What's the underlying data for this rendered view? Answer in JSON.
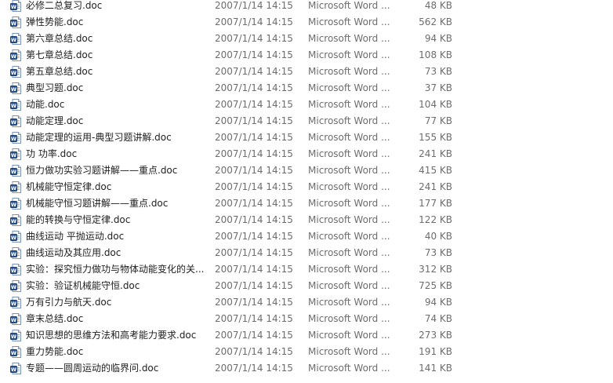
{
  "icons": {
    "file": "word-document-icon"
  },
  "colors": {
    "icon_blue": "#2b5797",
    "secondary_text": "#6d6d6d"
  },
  "files": [
    {
      "name": "必修二总复习.doc",
      "date": "2007/1/14 14:15",
      "type": "Microsoft Word ...",
      "size": "48 KB"
    },
    {
      "name": "弹性势能.doc",
      "date": "2007/1/14 14:15",
      "type": "Microsoft Word ...",
      "size": "562 KB"
    },
    {
      "name": "第六章总结.doc",
      "date": "2007/1/14 14:15",
      "type": "Microsoft Word ...",
      "size": "94 KB"
    },
    {
      "name": "第七章总结.doc",
      "date": "2007/1/14 14:15",
      "type": "Microsoft Word ...",
      "size": "108 KB"
    },
    {
      "name": "第五章总结.doc",
      "date": "2007/1/14 14:15",
      "type": "Microsoft Word ...",
      "size": "73 KB"
    },
    {
      "name": "典型习题.doc",
      "date": "2007/1/14 14:15",
      "type": "Microsoft Word ...",
      "size": "37 KB"
    },
    {
      "name": "动能.doc",
      "date": "2007/1/14 14:15",
      "type": "Microsoft Word ...",
      "size": "104 KB"
    },
    {
      "name": "动能定理.doc",
      "date": "2007/1/14 14:15",
      "type": "Microsoft Word ...",
      "size": "77 KB"
    },
    {
      "name": "动能定理的运用-典型习题讲解.doc",
      "date": "2007/1/14 14:15",
      "type": "Microsoft Word ...",
      "size": "155 KB"
    },
    {
      "name": "功 功率.doc",
      "date": "2007/1/14 14:15",
      "type": "Microsoft Word ...",
      "size": "241 KB"
    },
    {
      "name": "恒力做功实验习题讲解——重点.doc",
      "date": "2007/1/14 14:15",
      "type": "Microsoft Word ...",
      "size": "415 KB"
    },
    {
      "name": "机械能守恒定律.doc",
      "date": "2007/1/14 14:15",
      "type": "Microsoft Word ...",
      "size": "241 KB"
    },
    {
      "name": "机械能守恒习题讲解——重点.doc",
      "date": "2007/1/14 14:15",
      "type": "Microsoft Word ...",
      "size": "177 KB"
    },
    {
      "name": "能的转换与守恒定律.doc",
      "date": "2007/1/14 14:15",
      "type": "Microsoft Word ...",
      "size": "122 KB"
    },
    {
      "name": "曲线运动 平抛运动.doc",
      "date": "2007/1/14 14:15",
      "type": "Microsoft Word ...",
      "size": "40 KB"
    },
    {
      "name": "曲线运动及其应用.doc",
      "date": "2007/1/14 14:15",
      "type": "Microsoft Word ...",
      "size": "73 KB"
    },
    {
      "name": "实验：探究恒力做功与物体动能变化的关...",
      "date": "2007/1/14 14:15",
      "type": "Microsoft Word ...",
      "size": "312 KB"
    },
    {
      "name": "实验：验证机械能守恒.doc",
      "date": "2007/1/14 14:15",
      "type": "Microsoft Word ...",
      "size": "725 KB"
    },
    {
      "name": "万有引力与航天.doc",
      "date": "2007/1/14 14:15",
      "type": "Microsoft Word ...",
      "size": "94 KB"
    },
    {
      "name": "章末总结.doc",
      "date": "2007/1/14 14:15",
      "type": "Microsoft Word ...",
      "size": "74 KB"
    },
    {
      "name": "知识思想的思维方法和高考能力要求.doc",
      "date": "2007/1/14 14:15",
      "type": "Microsoft Word ...",
      "size": "273 KB"
    },
    {
      "name": "重力势能.doc",
      "date": "2007/1/14 14:15",
      "type": "Microsoft Word ...",
      "size": "191 KB"
    },
    {
      "name": "专题——圆周运动的临界问.doc",
      "date": "2007/1/14 14:15",
      "type": "Microsoft Word ...",
      "size": "141 KB"
    }
  ]
}
